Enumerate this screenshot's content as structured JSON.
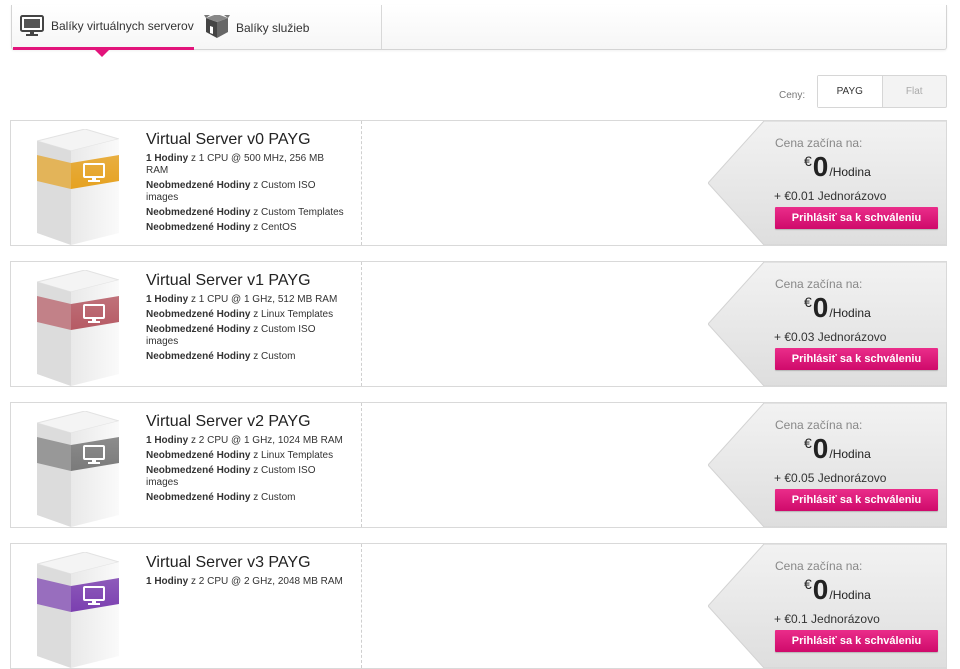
{
  "tabs": [
    {
      "label": "Balíky virtuálnych serverov",
      "icon": "monitor-icon",
      "active": true
    },
    {
      "label": "Balíky služieb",
      "icon": "package-box-icon",
      "active": false
    }
  ],
  "pricing": {
    "label": "Ceny:",
    "options": [
      {
        "label": "PAYG",
        "active": true
      },
      {
        "label": "Flat",
        "active": false
      }
    ]
  },
  "colors": {
    "accent": "#e2147b",
    "v0": "#e6a221",
    "v1": "#b65a64",
    "v2": "#7a7a7a",
    "v3": "#7b3fb0"
  },
  "packages": [
    {
      "title": "Virtual Server v0 PAYG",
      "features": [
        {
          "bold": "1 Hodiny",
          "text": " z 1 CPU @ 500 MHz, 256 MB RAM"
        },
        {
          "bold": "Neobmedzené Hodiny",
          "text": " z Custom ISO images"
        },
        {
          "bold": "Neobmedzené Hodiny",
          "text": " z Custom Templates"
        },
        {
          "bold": "Neobmedzené Hodiny",
          "text": " z CentOS"
        }
      ],
      "price_label": "Cena začína na:",
      "currency": "€",
      "price": "0",
      "unit": "/Hodina",
      "setup": "+ €0.01 Jednorázovo",
      "button": "Prihlásiť sa k schváleniu"
    },
    {
      "title": "Virtual Server v1 PAYG",
      "features": [
        {
          "bold": "1 Hodiny",
          "text": " z 1 CPU @ 1 GHz, 512 MB RAM"
        },
        {
          "bold": "Neobmedzené Hodiny",
          "text": " z Linux Templates"
        },
        {
          "bold": "Neobmedzené Hodiny",
          "text": " z Custom ISO images"
        },
        {
          "bold": "Neobmedzené Hodiny",
          "text": " z Custom"
        }
      ],
      "price_label": "Cena začína na:",
      "currency": "€",
      "price": "0",
      "unit": "/Hodina",
      "setup": "+ €0.03 Jednorázovo",
      "button": "Prihlásiť sa k schváleniu"
    },
    {
      "title": "Virtual Server v2 PAYG",
      "features": [
        {
          "bold": "1 Hodiny",
          "text": " z 2 CPU @ 1 GHz, 1024 MB RAM"
        },
        {
          "bold": "Neobmedzené Hodiny",
          "text": " z Linux Templates"
        },
        {
          "bold": "Neobmedzené Hodiny",
          "text": " z Custom ISO images"
        },
        {
          "bold": "Neobmedzené Hodiny",
          "text": " z Custom"
        }
      ],
      "price_label": "Cena začína na:",
      "currency": "€",
      "price": "0",
      "unit": "/Hodina",
      "setup": "+ €0.05 Jednorázovo",
      "button": "Prihlásiť sa k schváleniu"
    },
    {
      "title": "Virtual Server v3 PAYG",
      "features": [
        {
          "bold": "1 Hodiny",
          "text": " z 2 CPU @ 2 GHz, 2048 MB RAM"
        }
      ],
      "price_label": "Cena začína na:",
      "currency": "€",
      "price": "0",
      "unit": "/Hodina",
      "setup": "+ €0.1 Jednorázovo",
      "button": "Prihlásiť sa k schváleniu"
    }
  ]
}
